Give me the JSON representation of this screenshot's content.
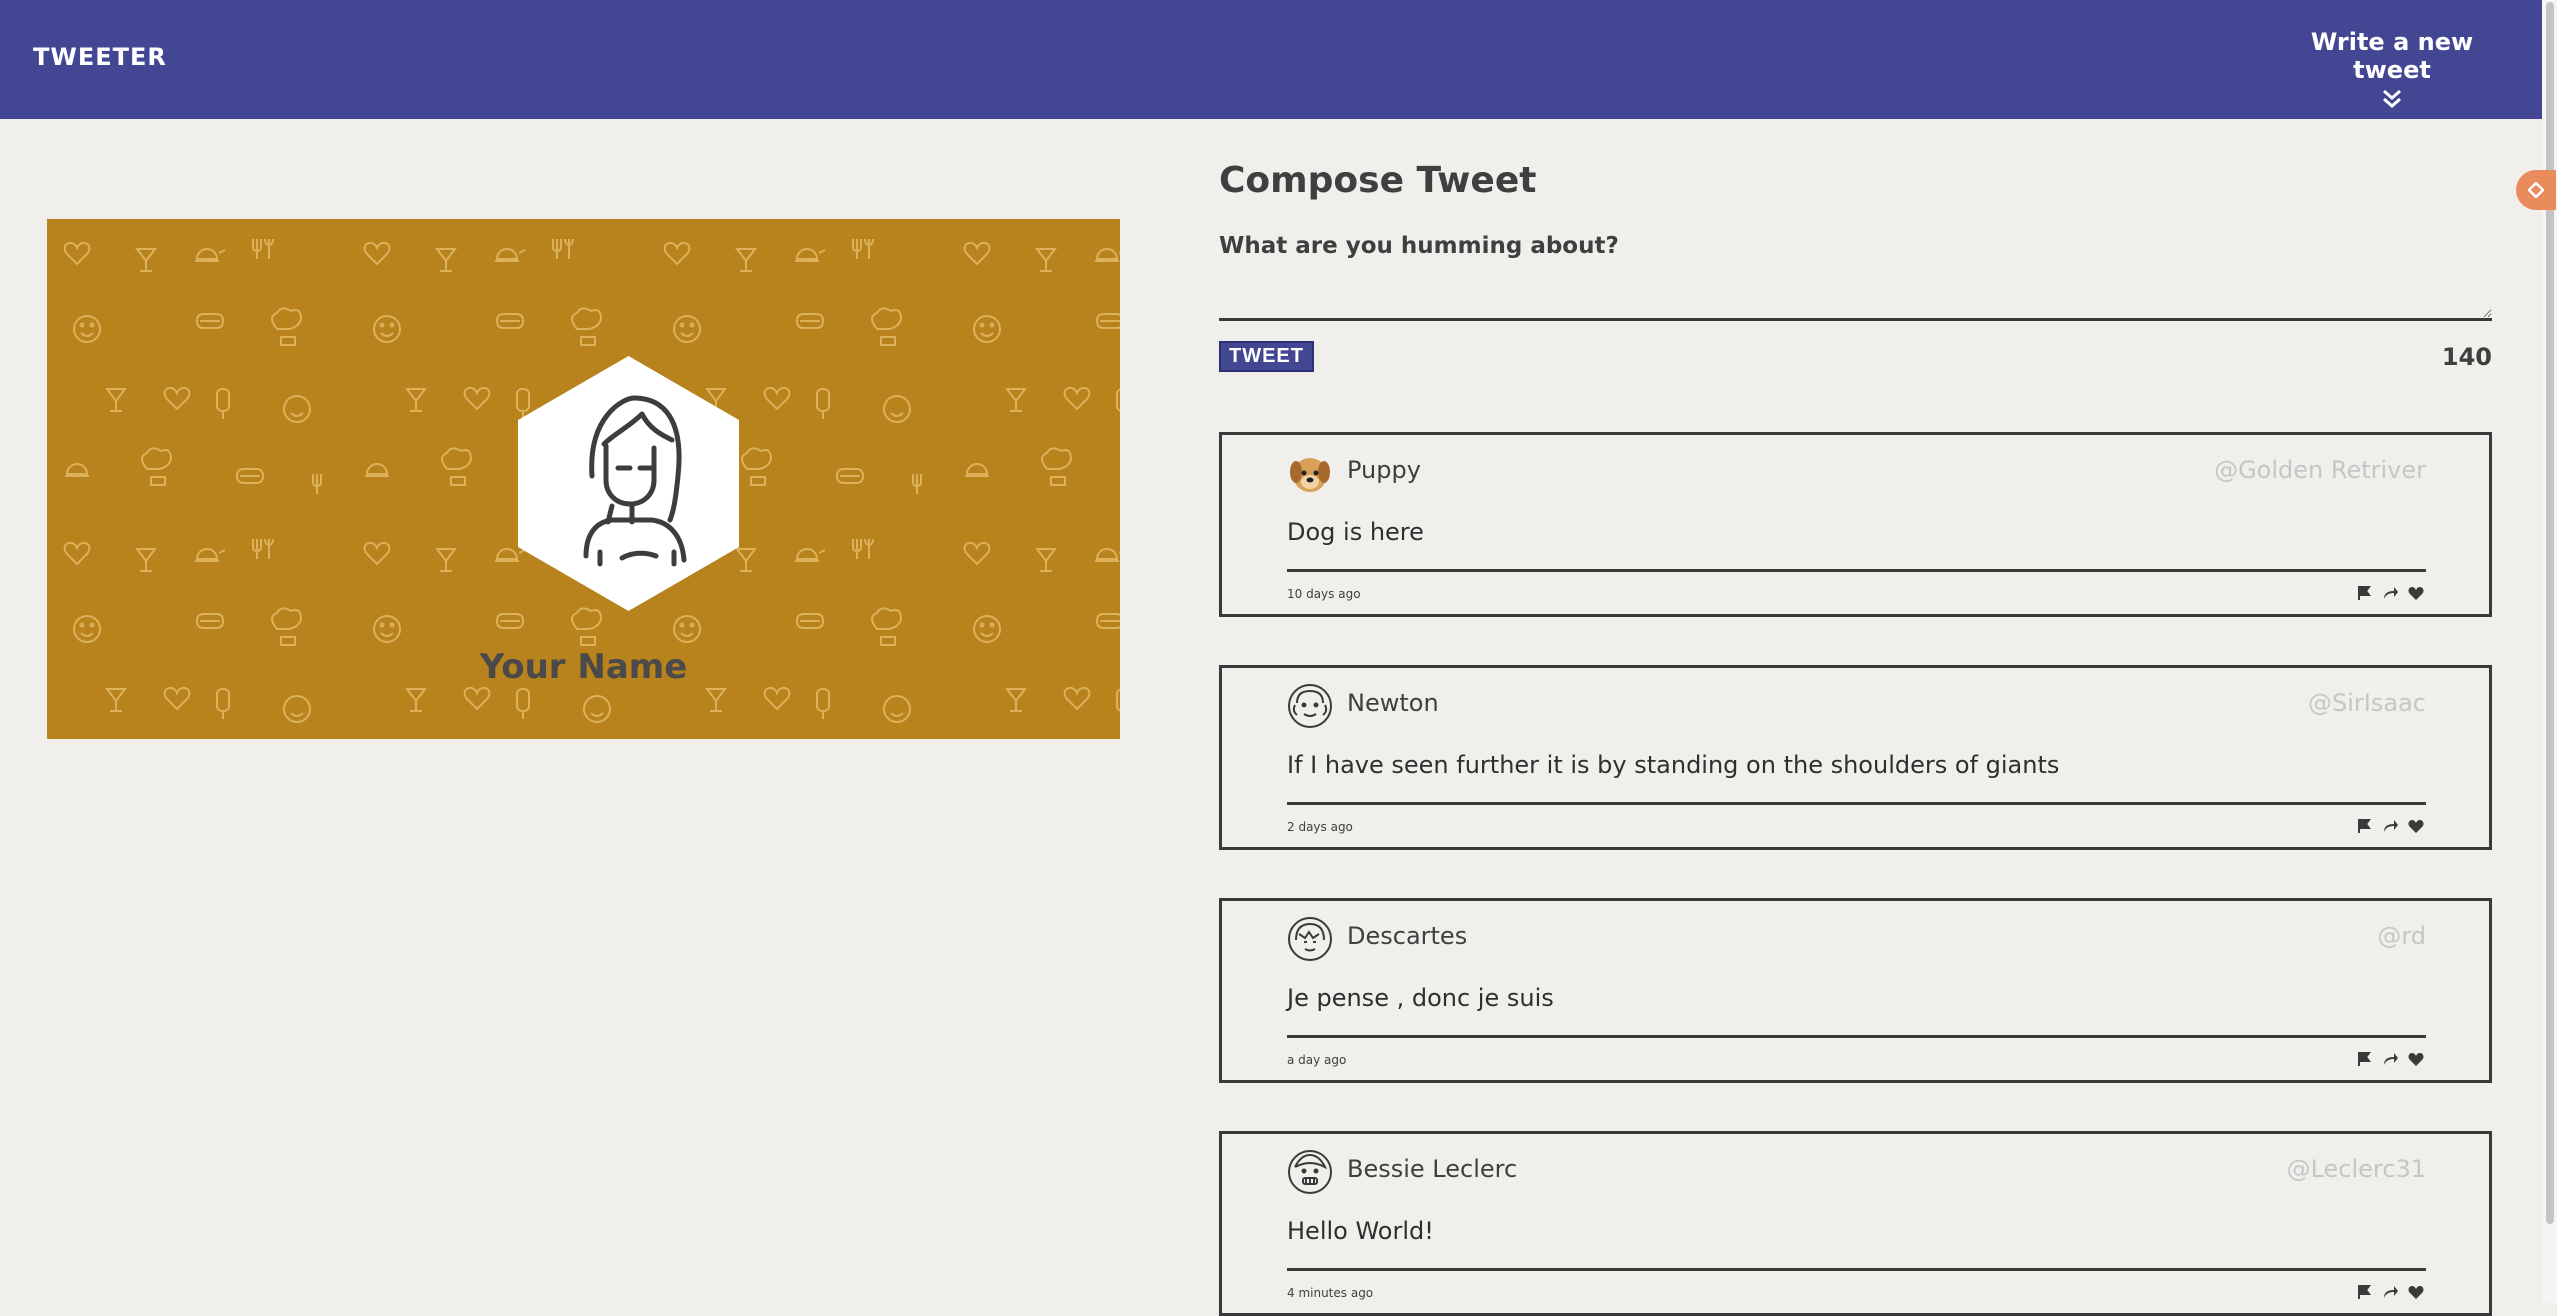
{
  "nav": {
    "brand": "TWEETER",
    "compose_toggle_label": "Write a new tweet",
    "compose_toggle_icon": "double-chevron-down-icon"
  },
  "profile": {
    "name": "Your Name",
    "banner_color": "#b8821c",
    "avatar_icon": "woman-avatar-icon"
  },
  "compose": {
    "title": "Compose Tweet",
    "prompt": "What are you humming about?",
    "textarea_value": "",
    "submit_label": "TWEET",
    "counter": "140"
  },
  "tweets": [
    {
      "name": "Puppy",
      "handle": "@Golden Retriver",
      "body": "Dog is here",
      "time": "10 days ago",
      "avatar": "puppy-avatar-icon"
    },
    {
      "name": "Newton",
      "handle": "@SirIsaac",
      "body": "If I have seen further it is by standing on the shoulders of giants",
      "time": "2 days ago",
      "avatar": "man-avatar-icon"
    },
    {
      "name": "Descartes",
      "handle": "@rd",
      "body": "Je pense , donc je suis",
      "time": "a day ago",
      "avatar": "bangs-avatar-icon"
    },
    {
      "name": "Bessie Leclerc",
      "handle": "@Leclerc31",
      "body": "Hello World!",
      "time": "4 minutes ago",
      "avatar": "grin-avatar-icon"
    }
  ],
  "tweet_actions": [
    "flag-icon",
    "retweet-icon",
    "heart-icon"
  ],
  "colors": {
    "nav": "#434793",
    "background": "#f0efeb",
    "accent_orange": "#e98b5c",
    "handle": "#c6c6c6"
  }
}
